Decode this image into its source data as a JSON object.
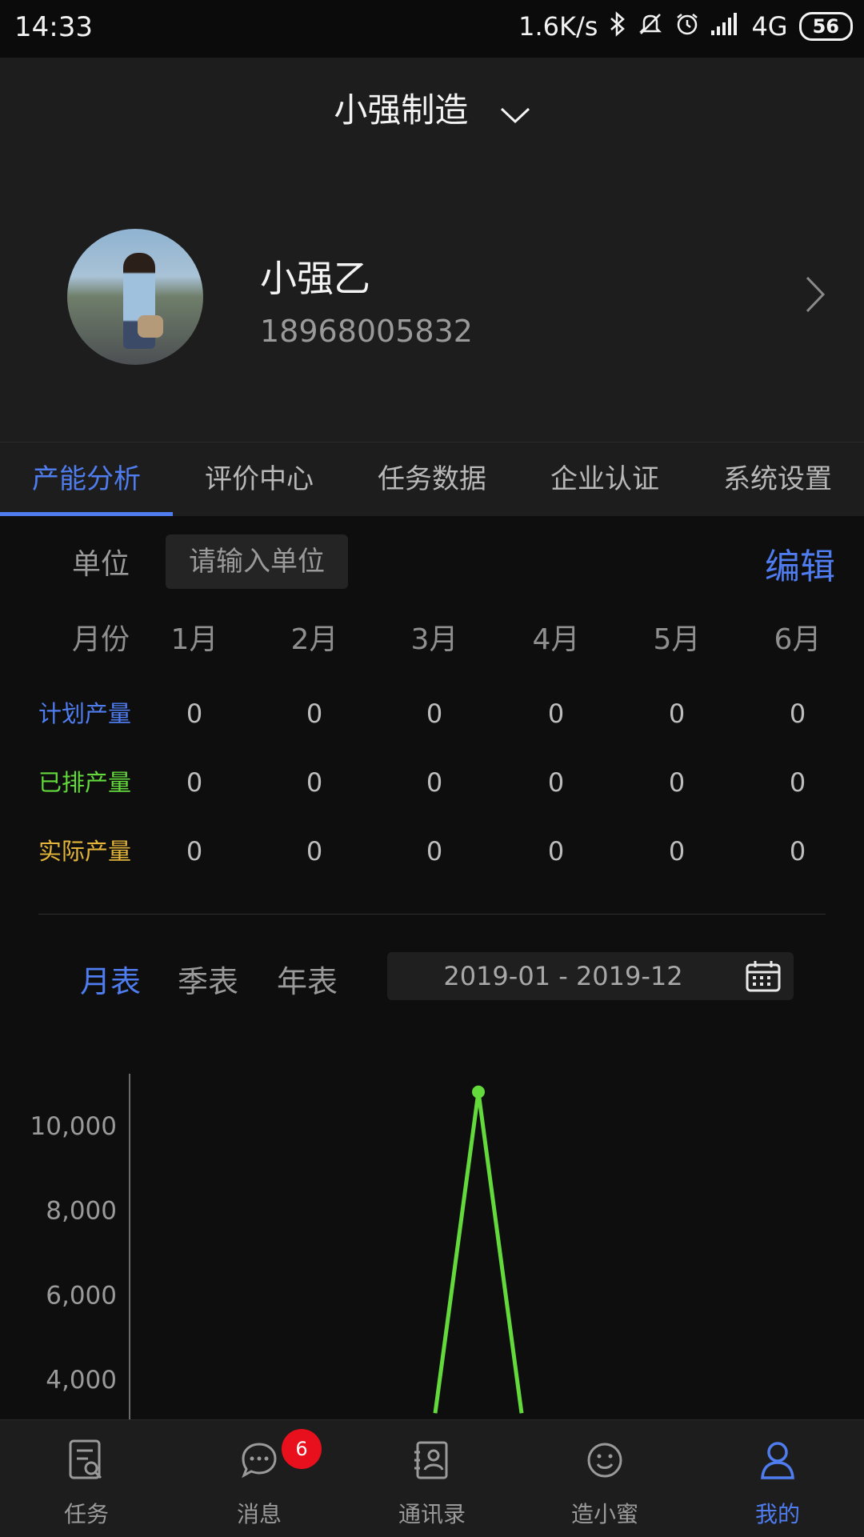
{
  "status_bar": {
    "time": "14:33",
    "net_speed": "1.6K/s",
    "network": "4G",
    "battery": "56",
    "icons": [
      "bluetooth-icon",
      "mute-icon",
      "alarm-icon",
      "signal-icon"
    ]
  },
  "header": {
    "company": "小强制造",
    "user_name": "小强乙",
    "phone": "18968005832"
  },
  "tabs": [
    {
      "label": "产能分析",
      "active": true
    },
    {
      "label": "评价中心",
      "active": false
    },
    {
      "label": "任务数据",
      "active": false
    },
    {
      "label": "企业认证",
      "active": false
    },
    {
      "label": "系统设置",
      "active": false
    }
  ],
  "unit": {
    "label": "单位",
    "placeholder": "请输入单位",
    "edit_label": "编辑"
  },
  "capacity_table": {
    "month_label": "月份",
    "months": [
      "1月",
      "2月",
      "3月",
      "4月",
      "5月",
      "6月"
    ],
    "rows": [
      {
        "label": "计划产量",
        "color": "#4f7df0",
        "values": [
          "0",
          "0",
          "0",
          "0",
          "0",
          "0"
        ]
      },
      {
        "label": "已排产量",
        "color": "#63d93c",
        "values": [
          "0",
          "0",
          "0",
          "0",
          "0",
          "0"
        ]
      },
      {
        "label": "实际产量",
        "color": "#e3b43a",
        "values": [
          "0",
          "0",
          "0",
          "0",
          "0",
          "0"
        ]
      }
    ]
  },
  "period_switch": {
    "options": [
      "月表",
      "季表",
      "年表"
    ],
    "active": "月表",
    "date_range": "2019-01 - 2019-12"
  },
  "chart_data": {
    "type": "line",
    "title": "",
    "xlabel": "",
    "ylabel": "",
    "yticks": [
      "10,000",
      "8,000",
      "6,000",
      "4,000"
    ],
    "ylim": [
      3200,
      11000
    ],
    "line_color": "#63d93c",
    "series": [
      {
        "x": [
          3.55,
          4,
          4.45
        ],
        "y": [
          3200,
          10800,
          3200
        ]
      }
    ]
  },
  "bottom_nav": [
    {
      "label": "任务",
      "icon": "task-icon",
      "active": false
    },
    {
      "label": "消息",
      "icon": "message-icon",
      "active": false,
      "badge": "6"
    },
    {
      "label": "通讯录",
      "icon": "contacts-icon",
      "active": false
    },
    {
      "label": "造小蜜",
      "icon": "smile-icon",
      "active": false
    },
    {
      "label": "我的",
      "icon": "profile-icon",
      "active": true
    }
  ]
}
